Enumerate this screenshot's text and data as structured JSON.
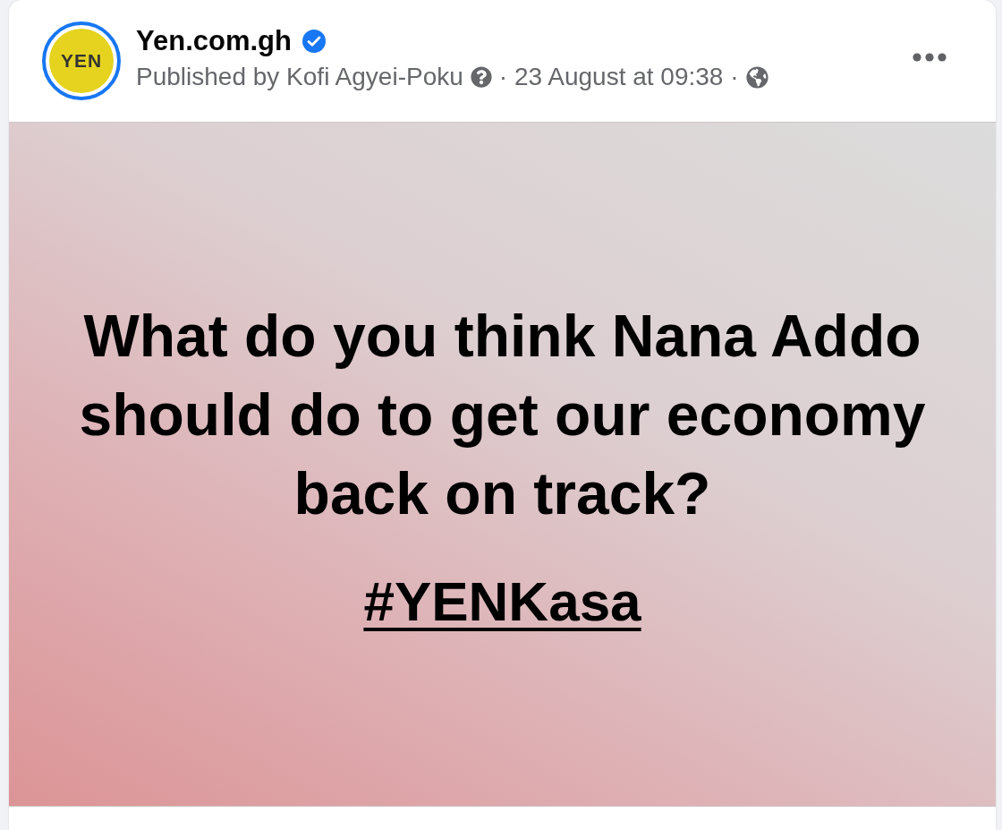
{
  "post": {
    "avatar_text": "YEN",
    "page_name": "Yen.com.gh",
    "verified": true,
    "published_by": "Published by Kofi Agyei-Poku",
    "date": "· 23 August at 09:38 ·"
  },
  "graphic": {
    "question": "What do you think Nana Addo\nshould do to get our economy\nback on track?",
    "hashtag": "#YENKasa"
  }
}
